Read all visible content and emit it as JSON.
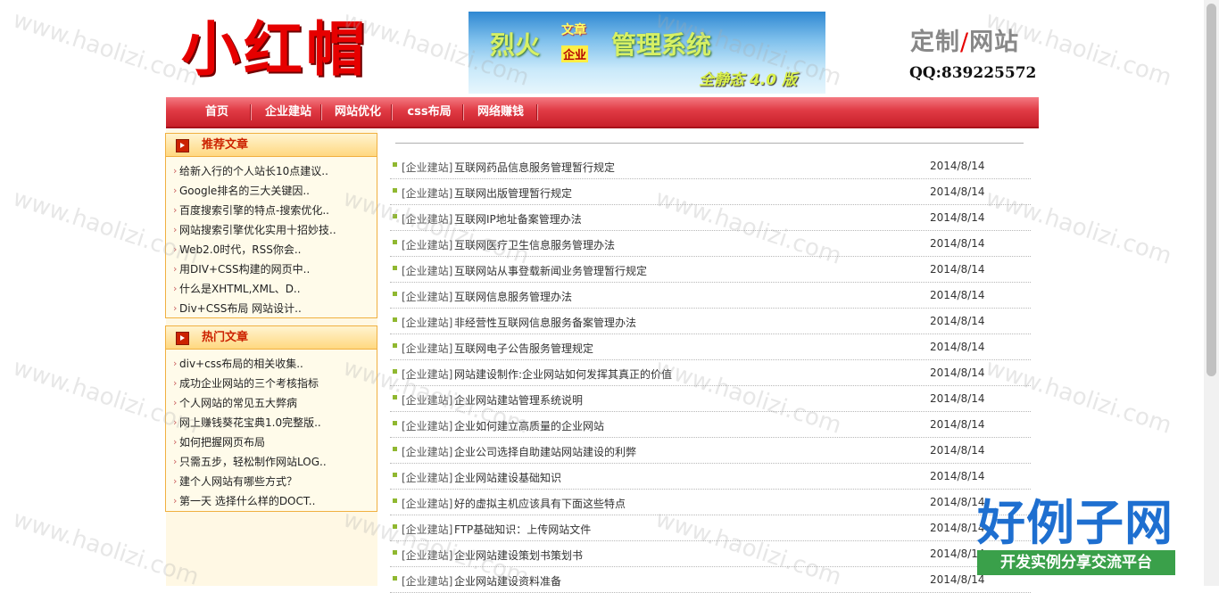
{
  "header": {
    "logo_text": "小红帽",
    "banner": {
      "brand_part1": "烈火",
      "tag_top": "文章",
      "tag_bottom": "企业",
      "brand_part2": "管理系统",
      "version": "全静态 4.0 版"
    },
    "brand_left": "定制",
    "brand_slash": "/",
    "brand_right": "网站",
    "qq": "QQ:839225572"
  },
  "nav": {
    "items": [
      "首页",
      "企业建站",
      "网站优化",
      "css布局",
      "网络赚钱"
    ]
  },
  "sidebar": {
    "recommended": {
      "title": "推荐文章",
      "items": [
        "给新入行的个人站长10点建议..",
        "Google排名的三大关键因..",
        "百度搜索引擎的特点-搜索优化..",
        "网站搜索引擎优化实用十招妙技..",
        "Web2.0时代，RSS你会..",
        "用DIV+CSS构建的网页中..",
        "什么是XHTML,XML、D..",
        "Div+CSS布局 网站设计.."
      ]
    },
    "hot": {
      "title": "热门文章",
      "items": [
        "div+css布局的相关收集..",
        "成功企业网站的三个考核指标",
        "个人网站的常见五大弊病",
        "网上赚钱葵花宝典1.0完整版..",
        "如何把握网页布局",
        "只需五步，轻松制作网站LOG..",
        "建个人网站有哪些方式？",
        "第一天 选择什么样的DOCT.."
      ]
    }
  },
  "articles": [
    {
      "category": "[企业建站]",
      "title": "互联网药品信息服务管理暂行规定",
      "date": "2014/8/14"
    },
    {
      "category": "[企业建站]",
      "title": "互联网出版管理暂行规定",
      "date": "2014/8/14"
    },
    {
      "category": "[企业建站]",
      "title": "互联网IP地址备案管理办法",
      "date": "2014/8/14"
    },
    {
      "category": "[企业建站]",
      "title": "互联网医疗卫生信息服务管理办法",
      "date": "2014/8/14"
    },
    {
      "category": "[企业建站]",
      "title": "互联网站从事登载新闻业务管理暂行规定",
      "date": "2014/8/14"
    },
    {
      "category": "[企业建站]",
      "title": "互联网信息服务管理办法",
      "date": "2014/8/14"
    },
    {
      "category": "[企业建站]",
      "title": "非经营性互联网信息服务备案管理办法",
      "date": "2014/8/14"
    },
    {
      "category": "[企业建站]",
      "title": "互联网电子公告服务管理规定",
      "date": "2014/8/14"
    },
    {
      "category": "[企业建站]",
      "title": "网站建设制作:企业网站如何发挥其真正的价值",
      "date": "2014/8/14"
    },
    {
      "category": "[企业建站]",
      "title": "企业网站建站管理系统说明",
      "date": "2014/8/14"
    },
    {
      "category": "[企业建站]",
      "title": "企业如何建立高质量的企业网站",
      "date": "2014/8/14"
    },
    {
      "category": "[企业建站]",
      "title": "企业公司选择自助建站网站建设的利弊",
      "date": "2014/8/14"
    },
    {
      "category": "[企业建站]",
      "title": "企业网站建设基础知识",
      "date": "2014/8/14"
    },
    {
      "category": "[企业建站]",
      "title": "好的虚拟主机应该具有下面这些特点",
      "date": "2014/8/14"
    },
    {
      "category": "[企业建站]",
      "title": "FTP基础知识：上传网站文件",
      "date": "2014/8/14"
    },
    {
      "category": "[企业建站]",
      "title": "企业网站建设策划书策划书",
      "date": "2014/8/14"
    },
    {
      "category": "[企业建站]",
      "title": "企业网站建设资料准备",
      "date": "2014/8/14"
    }
  ],
  "watermark": {
    "text": "www.haolizi.com",
    "badge_big": "好例子网",
    "badge_small": "开发实例分享交流平台"
  },
  "colors": {
    "nav_red": "#e03a44",
    "logo_red": "#e60000",
    "sidebar_title": "#cc2200",
    "sidebar_border": "#f0b040",
    "bullet_green": "#90b830",
    "badge_blue": "#1e6fd0",
    "badge_green": "#3aa04a"
  }
}
